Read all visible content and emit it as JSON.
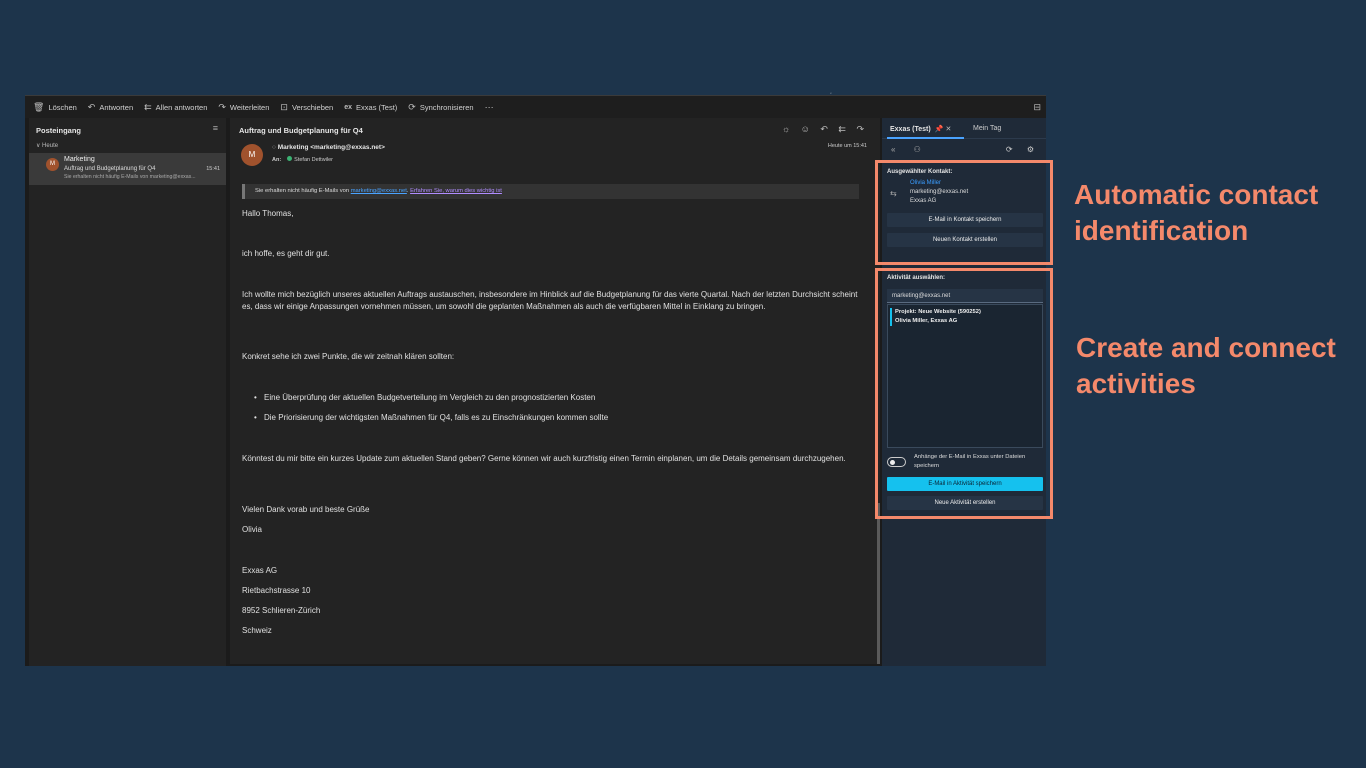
{
  "toolbar": {
    "items": [
      {
        "icon": "trash-icon",
        "glyph": "🗑",
        "label": "Löschen"
      },
      {
        "icon": "reply-icon",
        "glyph": "↶",
        "label": "Antworten"
      },
      {
        "icon": "reply-all-icon",
        "glyph": "⇇",
        "label": "Allen antworten"
      },
      {
        "icon": "forward-icon",
        "glyph": "↷",
        "label": "Weiterleiten"
      },
      {
        "icon": "move-icon",
        "glyph": "⊡",
        "label": "Verschieben"
      },
      {
        "icon": "exxas-icon",
        "glyph": "ex",
        "label": "Exxas (Test)"
      },
      {
        "icon": "sync-icon",
        "glyph": "⟳",
        "label": "Synchronisieren"
      },
      {
        "icon": "more-icon",
        "glyph": "⋯",
        "label": ""
      }
    ],
    "right_glyph": "⊟"
  },
  "folders": {
    "title": "Posteingang",
    "filter_glyph": "≡",
    "group": "∨  Heute",
    "message": {
      "avatar": "M",
      "from": "Marketing",
      "subject": "Auftrag und Budgetplanung für Q4",
      "preview": "Sie erhalten nicht häufig E-Mails von marketing@exxas...",
      "time": "15:41"
    }
  },
  "reading": {
    "subject": "Auftrag und Budgetplanung für Q4",
    "actions_glyphs": "☼ ☺ ↶ ⇇ ↷",
    "sender_avatar": "M",
    "sender_prefix": "○",
    "sender": "Marketing <marketing@exxas.net>",
    "to_label": "An:",
    "to_name": "Stefan Dettwiler",
    "received": "Heute um 15:41",
    "banner": {
      "text": "Sie erhalten nicht häufig E-Mails von ",
      "email_link": "marketing@exxas.net",
      "sep": ". ",
      "learn_link": "Erfahren Sie, warum dies wichtig ist"
    },
    "greeting": "Hallo Thomas,",
    "p1": "ich hoffe, es geht dir gut.",
    "p2": "Ich wollte mich bezüglich unseres aktuellen Auftrags austauschen, insbesondere im Hinblick auf die Budgetplanung für das vierte Quartal. Nach der letzten Durchsicht scheint es, dass wir einige Anpassungen vornehmen müssen, um sowohl die geplanten Maßnahmen als auch die verfügbaren Mittel in Einklang zu bringen.",
    "p3": "Konkret sehe ich zwei Punkte, die wir zeitnah klären sollten:",
    "bullets": [
      "Eine Überprüfung der aktuellen Budgetverteilung im Vergleich zu den prognostizierten Kosten",
      "Die Priorisierung der wichtigsten Maßnahmen für Q4, falls es zu Einschränkungen kommen sollte"
    ],
    "p4": "Könntest du mir bitte ein kurzes Update zum aktuellen Stand geben? Gerne können wir auch kurzfristig einen Termin einplanen, um die Details gemeinsam durchzugehen.",
    "closing": "Vielen Dank vorab und beste Grüße",
    "signoff": "Olivia",
    "sig_company": "Exxas AG",
    "sig_street": "Rietbachstrasse 10",
    "sig_city": "8952 Schlieren-Zürich",
    "sig_country": "Schweiz"
  },
  "addin": {
    "tab_exxas": "Exxas (Test)",
    "tab_mein": "Mein Tag",
    "icons_left": "« ⚇",
    "icons_right": "⟳ ⚙",
    "contact_label": "Ausgewählter Kontakt:",
    "contact_icon": "⇆",
    "contact_name": "Olivia Miller",
    "contact_email": "marketing@exxas.net",
    "contact_company": "Exxas AG",
    "btn_save_email_contact": "E-Mail in Kontakt speichern",
    "btn_new_contact": "Neuen Kontakt erstellen",
    "activity_label": "Aktivität auswählen:",
    "activity_search_value": "marketing@exxas.net",
    "activity_selected_line1": "Projekt: Neue Website (590252)",
    "activity_selected_line2": "Olivia Miller, Exxas AG",
    "toggle_label": "Anhänge der E-Mail in Exxas unter Dateien speichern",
    "btn_save_email_activity": "E-Mail in Aktivität speichern",
    "btn_new_activity": "Neue Aktivität erstellen"
  },
  "callouts": {
    "contact_line1": "Automatic contact",
    "contact_line2": "identification",
    "activity_line1": "Create and connect",
    "activity_line2": "activities"
  },
  "colors": {
    "background": "#1d344b",
    "highlight": "#f4896b",
    "primary_button": "#15c1ee",
    "link": "#3a9dff"
  }
}
